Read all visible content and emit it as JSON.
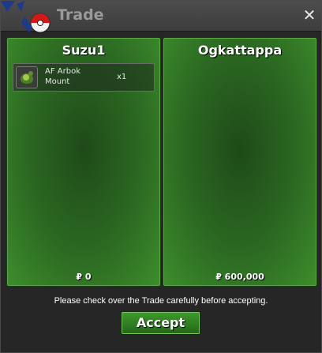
{
  "window": {
    "title": "Trade",
    "close_icon": "close-x-icon"
  },
  "left_panel": {
    "name": "Suzu1",
    "items": [
      {
        "name": "AF Arbok Mount",
        "quantity": "x1",
        "icon": "arbok-mount-icon"
      }
    ],
    "money": "₽ 0"
  },
  "right_panel": {
    "name": "Ogkattappa",
    "items": [],
    "money": "₽ 600,000"
  },
  "footer": {
    "notice": "Please check over the Trade carefully before accepting.",
    "accept_label": "Accept"
  },
  "colors": {
    "panel_green": "#2c6a22",
    "button_green": "#3f9a2c",
    "title_bg": "#444444"
  }
}
